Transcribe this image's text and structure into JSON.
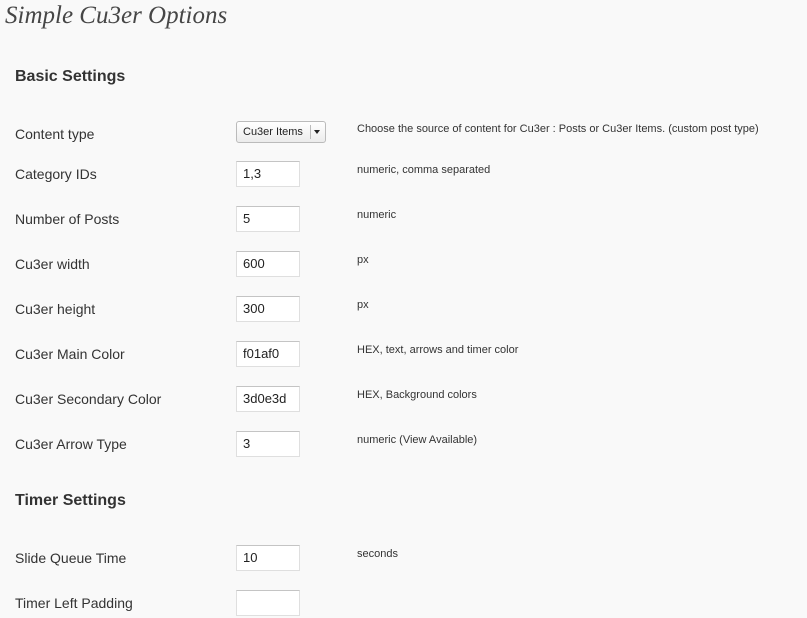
{
  "page_title": "Simple Cu3er Options",
  "sections": {
    "basic": {
      "title": "Basic Settings"
    },
    "timer": {
      "title": "Timer Settings"
    }
  },
  "content_type": {
    "label": "Content type",
    "selected": "Cu3er Items",
    "description": "Choose the source of content for Cu3er : Posts or Cu3er Items. (custom post type)"
  },
  "basic_fields": [
    {
      "label": "Category IDs",
      "value": "1,3",
      "description": "numeric, comma separated"
    },
    {
      "label": "Number of Posts",
      "value": "5",
      "description": "numeric"
    },
    {
      "label": "Cu3er width",
      "value": "600",
      "description": "px"
    },
    {
      "label": "Cu3er height",
      "value": "300",
      "description": "px"
    },
    {
      "label": "Cu3er Main Color",
      "value": "f01af0",
      "description": "HEX, text, arrows and timer color"
    },
    {
      "label": "Cu3er Secondary Color",
      "value": "3d0e3d",
      "description": "HEX, Background colors"
    },
    {
      "label": "Cu3er Arrow Type",
      "value": "3",
      "description": "numeric (View Available)"
    }
  ],
  "timer_fields": [
    {
      "label": "Slide Queue Time",
      "value": "10",
      "description": "seconds"
    },
    {
      "label": "Timer Left Padding",
      "value": "",
      "description": ""
    }
  ]
}
